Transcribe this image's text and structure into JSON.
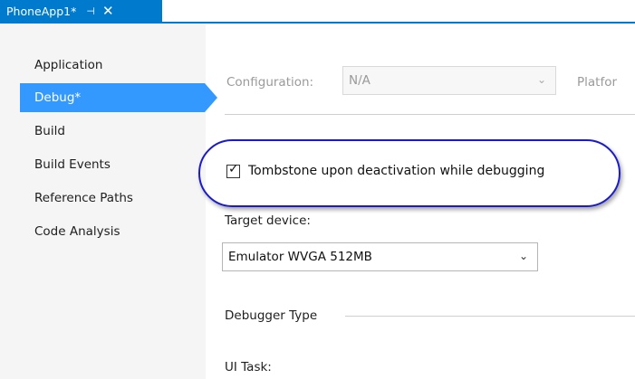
{
  "tab": {
    "title": "PhoneApp1*",
    "pin_icon": "pin-icon",
    "close_icon": "close-icon"
  },
  "sidebar": {
    "items": [
      {
        "label": "Application",
        "selected": false
      },
      {
        "label": "Debug*",
        "selected": true
      },
      {
        "label": "Build",
        "selected": false
      },
      {
        "label": "Build Events",
        "selected": false
      },
      {
        "label": "Reference Paths",
        "selected": false
      },
      {
        "label": "Code Analysis",
        "selected": false
      }
    ]
  },
  "config": {
    "configuration_label": "Configuration:",
    "configuration_value": "N/A",
    "platform_label": "Platfor"
  },
  "tombstone": {
    "label": "Tombstone upon deactivation while debugging",
    "checked": true
  },
  "target": {
    "label": "Target device:",
    "value": "Emulator WVGA 512MB"
  },
  "debugger": {
    "label": "Debugger Type",
    "ui_task_label": "UI Task:"
  },
  "colors": {
    "accent": "#007acc",
    "selection": "#3399ff",
    "highlight_ellipse": "#1a1acc"
  }
}
